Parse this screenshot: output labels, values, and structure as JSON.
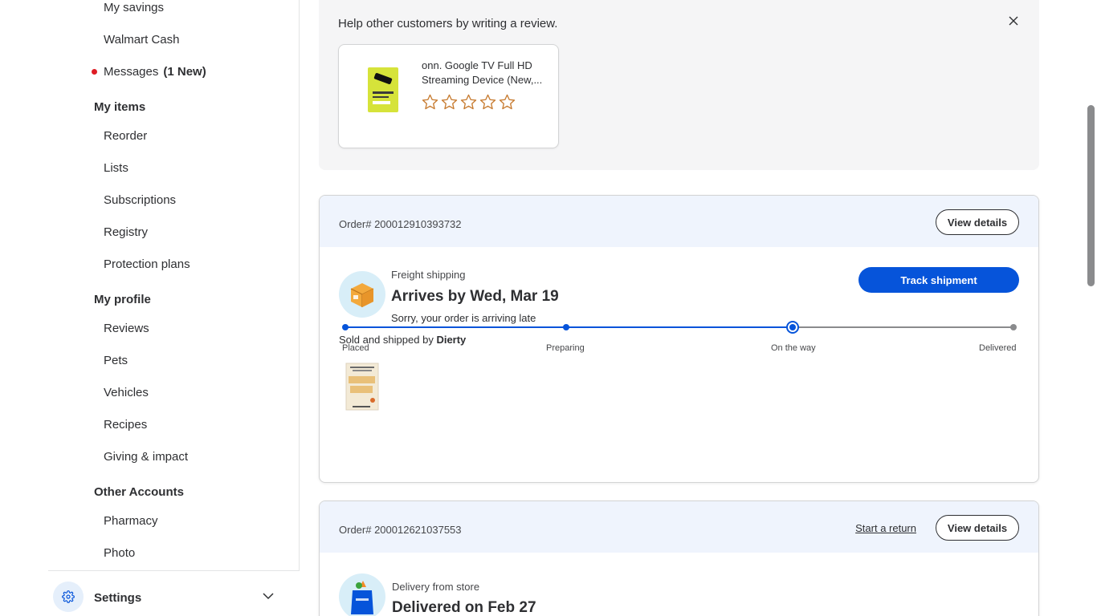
{
  "sidebar": {
    "links_top": [
      "My savings",
      "Walmart Cash"
    ],
    "messages": {
      "label": "Messages",
      "badge": "(1 New)"
    },
    "sections": [
      {
        "heading": "My items",
        "items": [
          "Reorder",
          "Lists",
          "Subscriptions",
          "Registry",
          "Protection plans"
        ]
      },
      {
        "heading": "My profile",
        "items": [
          "Reviews",
          "Pets",
          "Vehicles",
          "Recipes",
          "Giving & impact"
        ]
      },
      {
        "heading": "Other Accounts",
        "items": [
          "Pharmacy",
          "Photo"
        ]
      }
    ],
    "settings_label": "Settings"
  },
  "review": {
    "prompt": "Help other customers by writing a review.",
    "product_name": "onn. Google TV Full HD Streaming Device (New,...",
    "rating": 0,
    "max_rating": 5
  },
  "orders": [
    {
      "number": "Order# 200012910393732",
      "view_details": "View details",
      "shipping_type": "Freight shipping",
      "status": "Arrives by Wed, Mar 19",
      "note": "Sorry, your order is arriving late",
      "sold_by_prefix": "Sold and shipped by ",
      "seller": "Dierty",
      "track_label": "Track shipment",
      "steps": [
        "Placed",
        "Preparing",
        "On the way",
        "Delivered"
      ],
      "current_step": 2
    },
    {
      "number": "Order# 200012621037553",
      "start_return": "Start a return",
      "view_details": "View details",
      "shipping_type": "Delivery from store",
      "status": "Delivered on Feb 27"
    }
  ],
  "colors": {
    "primary": "#0654da",
    "order_header": "#eff4fd",
    "review_bg": "#f5f5f6",
    "alert_dot": "#de1c24",
    "star": "#c77b30"
  }
}
